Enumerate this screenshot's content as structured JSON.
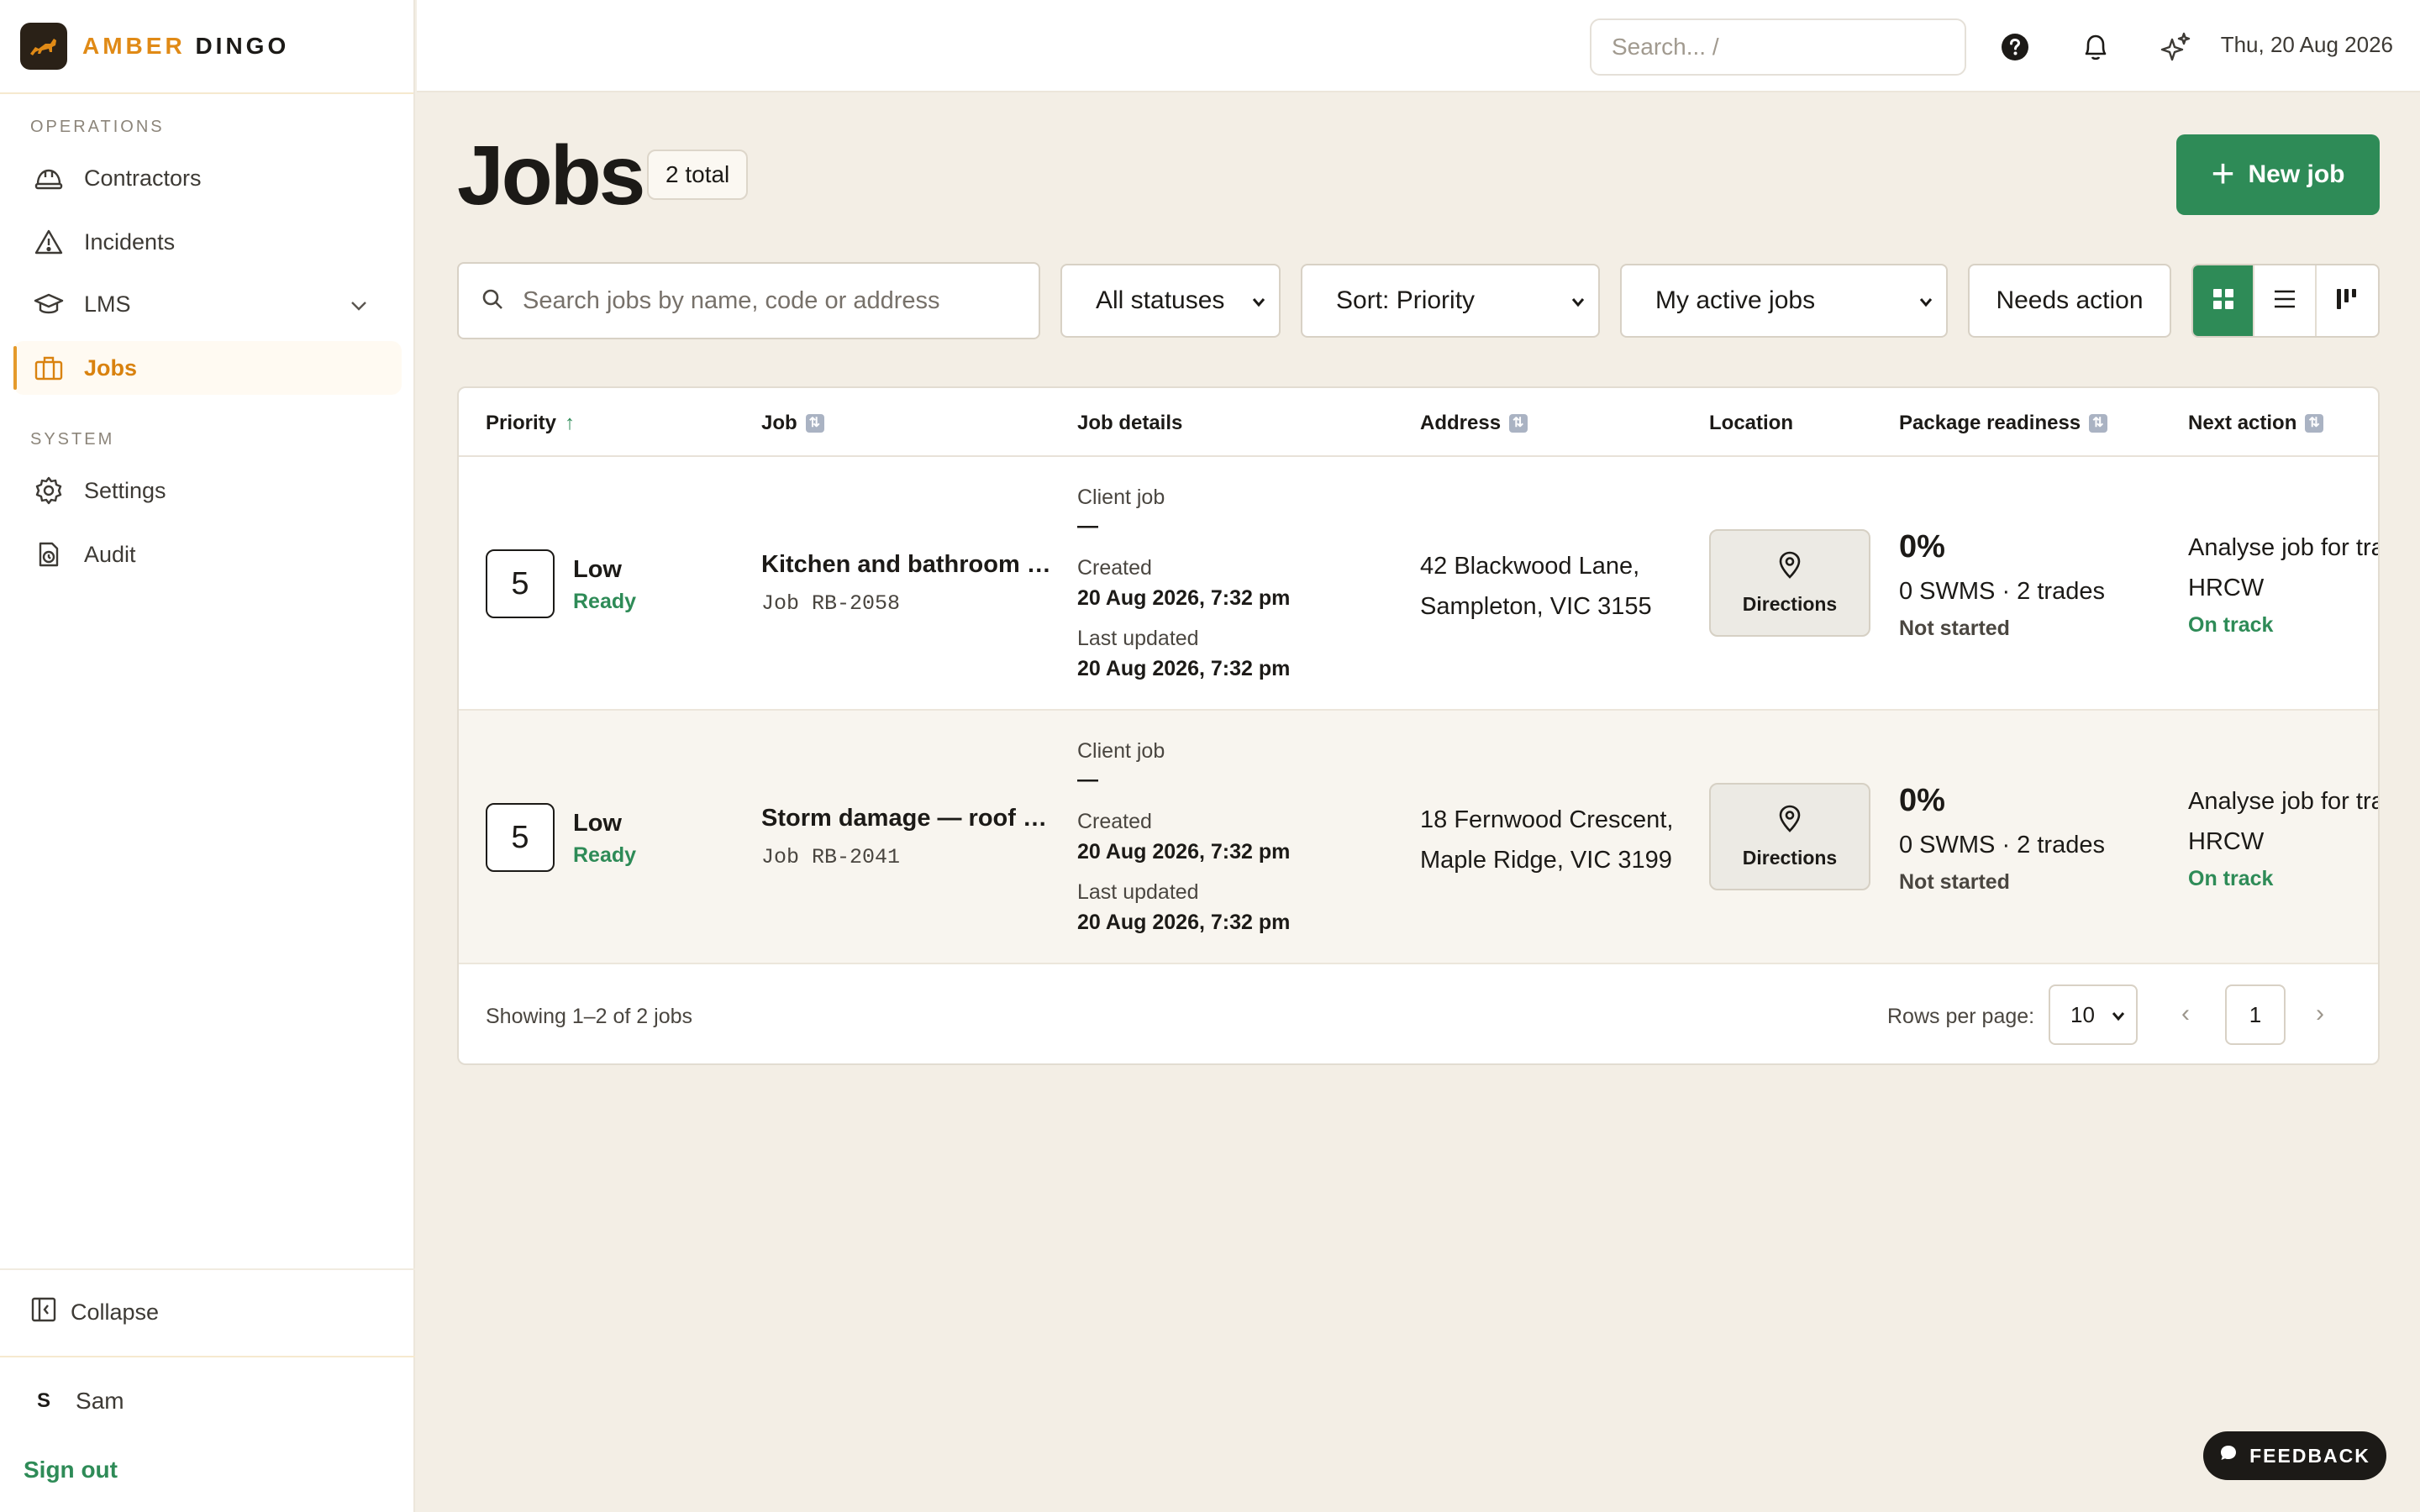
{
  "brand": {
    "name_part1": "AMBER",
    "name_part2": "DINGO"
  },
  "sidebar": {
    "sections": [
      {
        "label": "OPERATIONS"
      },
      {
        "label": "SYSTEM"
      }
    ],
    "items": [
      {
        "label": "Contractors",
        "icon": "hard-hat-icon"
      },
      {
        "label": "Incidents",
        "icon": "warning-triangle-icon"
      },
      {
        "label": "LMS",
        "icon": "graduation-cap-icon"
      },
      {
        "label": "Jobs",
        "icon": "briefcase-icon",
        "active": true
      },
      {
        "label": "Settings",
        "icon": "gear-icon"
      },
      {
        "label": "Audit",
        "icon": "audit-clock-icon"
      }
    ],
    "collapse_label": "Collapse",
    "user": {
      "initial": "S",
      "name": "Sam"
    },
    "sign_out": "Sign out"
  },
  "topbar": {
    "search_placeholder": "Search...  /",
    "date": "Thu, 20 Aug 2026"
  },
  "page": {
    "title": "Jobs",
    "total_badge": "2 total",
    "new_job_label": "New job"
  },
  "filters": {
    "search_placeholder": "Search jobs by name, code or address",
    "status": "All statuses",
    "sort": "Sort: Priority",
    "scope": "My active jobs",
    "needs_action": "Needs action"
  },
  "table": {
    "headers": {
      "priority": "Priority",
      "job": "Job",
      "details": "Job details",
      "address": "Address",
      "location": "Location",
      "package": "Package readiness",
      "next_action": "Next action"
    },
    "rows": [
      {
        "priority": "5",
        "priority_label": "Low",
        "priority_status": "Ready",
        "job_name": "Kitchen and bathroom renovation",
        "job_code": "Job RB-2058",
        "client_label": "Client job",
        "client_value": "—",
        "created_label": "Created",
        "created_value": "20 Aug 2026, 7:32 pm",
        "updated_label": "Last updated",
        "updated_value": "20 Aug 2026, 7:32 pm",
        "address_line1": "42 Blackwood Lane,",
        "address_line2": "Sampleton, VIC 3155",
        "directions_label": "Directions",
        "package_pct": "0%",
        "package_sub": "0 SWMS · 2 trades",
        "package_state": "Not started",
        "next_action_line1": "Analyse job for trades",
        "next_action_line2": "HRCW",
        "next_action_status": "On track"
      },
      {
        "priority": "5",
        "priority_label": "Low",
        "priority_status": "Ready",
        "job_name": "Storm damage — roof and gutter repairs",
        "job_code": "Job RB-2041",
        "client_label": "Client job",
        "client_value": "—",
        "created_label": "Created",
        "created_value": "20 Aug 2026, 7:32 pm",
        "updated_label": "Last updated",
        "updated_value": "20 Aug 2026, 7:32 pm",
        "address_line1": "18 Fernwood Crescent,",
        "address_line2": "Maple Ridge, VIC 3199",
        "directions_label": "Directions",
        "package_pct": "0%",
        "package_sub": "0 SWMS · 2 trades",
        "package_state": "Not started",
        "next_action_line1": "Analyse job for trades",
        "next_action_line2": "HRCW",
        "next_action_status": "On track"
      }
    ],
    "footer": {
      "showing": "Showing 1–2 of 2 jobs",
      "rows_per_page_label": "Rows per page:",
      "rows_per_page": "10",
      "current_page": "1"
    }
  },
  "feedback_label": "FEEDBACK",
  "colors": {
    "accent": "#2e8b57",
    "brand": "#e08a16",
    "background": "#f3eee5"
  }
}
